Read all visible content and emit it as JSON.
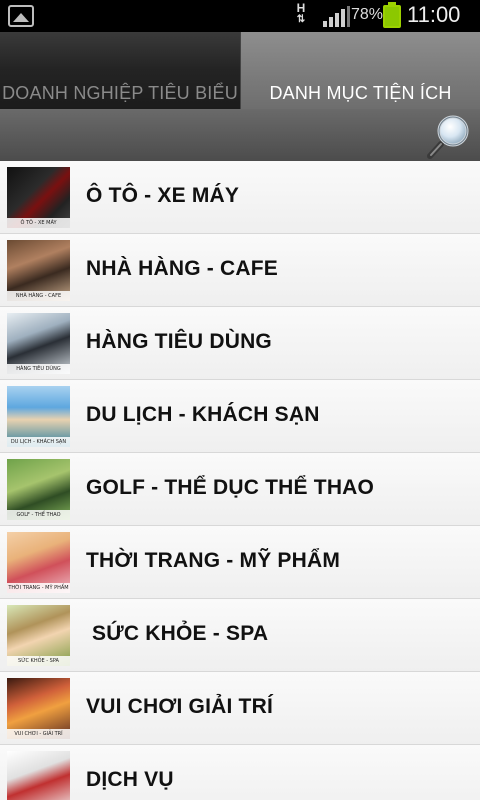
{
  "status_bar": {
    "network": "H",
    "battery": "78%",
    "time": "11:00"
  },
  "tabs": [
    {
      "label": "DOANH NGHIỆP TIÊU BIỂU",
      "selected": false
    },
    {
      "label": "DANH MỤC TIỆN ÍCH",
      "selected": true
    }
  ],
  "categories": [
    {
      "label": "Ô TÔ - XE MÁY",
      "thumb_caption": "Ô TÔ - XE MÁY"
    },
    {
      "label": "NHÀ HÀNG - CAFE",
      "thumb_caption": "NHÀ HÀNG - CAFE"
    },
    {
      "label": "HÀNG TIÊU DÙNG",
      "thumb_caption": "HÀNG TIÊU DÙNG"
    },
    {
      "label": "DU LỊCH - KHÁCH SẠN",
      "thumb_caption": "DU LỊCH - KHÁCH SẠN"
    },
    {
      "label": "GOLF - THỂ DỤC THỂ THAO",
      "thumb_caption": "GOLF - THỂ THAO"
    },
    {
      "label": "THỜI TRANG - MỸ PHẨM",
      "thumb_caption": "THỜI TRANG - MỸ PHẨM"
    },
    {
      "label": " SỨC KHỎE - SPA",
      "thumb_caption": "SỨC KHỎE - SPA"
    },
    {
      "label": "VUI CHƠI GIẢI TRÍ",
      "thumb_caption": "VUI CHƠI - GIẢI TRÍ"
    },
    {
      "label": "DỊCH VỤ",
      "thumb_caption": ""
    }
  ],
  "icons": {
    "gallery": "gallery-icon",
    "signal": "signal-icon",
    "battery": "battery-icon",
    "search": "search-icon"
  }
}
